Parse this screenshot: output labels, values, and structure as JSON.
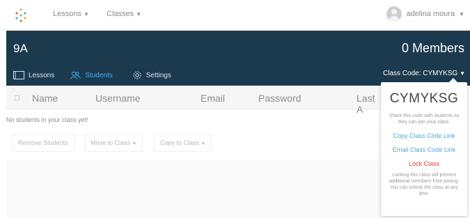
{
  "nav": {
    "items": [
      {
        "label": "Lessons"
      },
      {
        "label": "Classes"
      }
    ],
    "user_name": "adelina moura"
  },
  "header": {
    "class_name": "9A",
    "members": "0 Members",
    "tabs": [
      {
        "label": "Lessons",
        "icon": "slideshow-icon"
      },
      {
        "label": "Students",
        "icon": "students-icon"
      },
      {
        "label": "Settings",
        "icon": "gear-icon"
      }
    ],
    "class_code_label": "Class Code: CYMYKSG"
  },
  "table": {
    "columns": [
      "Name",
      "Username",
      "Email",
      "Password",
      "Last A"
    ],
    "empty_message": "No students in your class yet!"
  },
  "actions": {
    "remove": "Remove Students",
    "move": "Move to Class",
    "copy": "Copy to Class"
  },
  "popover": {
    "code": "CYMYKSG",
    "share_text": "Share this code with students so they can join your class.",
    "copy_link": "Copy Class Code Link",
    "email_link": "Email Class Code Link",
    "lock": "Lock Class",
    "lock_text": "Locking this class will prevent additional members from joining. You can unlock the class at any time."
  },
  "colors": {
    "header_bg": "#1b3a4e",
    "accent": "#4aa8e0",
    "danger": "#e2412f"
  }
}
